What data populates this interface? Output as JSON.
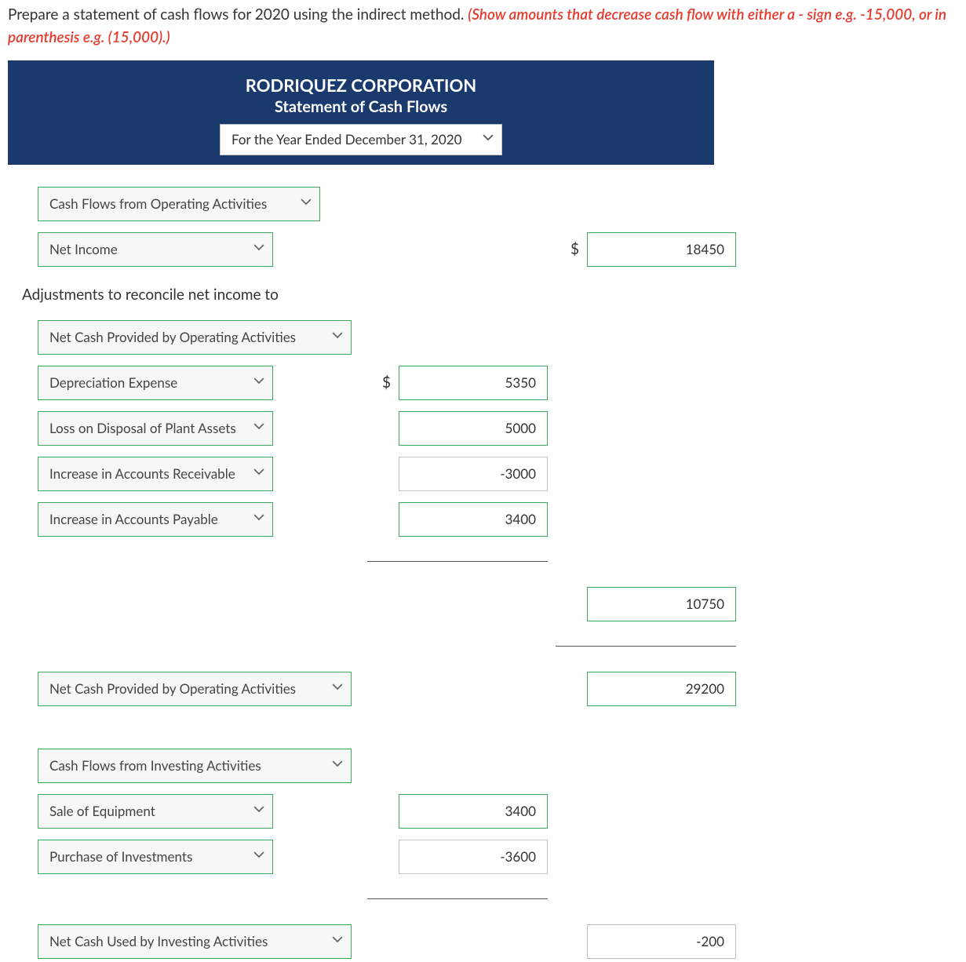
{
  "prompt": {
    "black": "Prepare a statement of cash flows for 2020 using the indirect method. ",
    "red": "(Show amounts that decrease cash flow with either a - sign e.g. -15,000, or in parenthesis e.g. (15,000).)"
  },
  "header": {
    "company": "RODRIQUEZ CORPORATION",
    "subtitle": "Statement of Cash Flows",
    "period": "For the Year Ended December 31, 2020"
  },
  "labels": {
    "cfo_header": "Cash Flows from Operating Activities",
    "net_income": "Net Income",
    "adjust_text": "Adjustments to reconcile net income to",
    "ncp_by_oa": "Net Cash Provided by Operating Activities",
    "depreciation": "Depreciation Expense",
    "loss_disposal": "Loss on Disposal of Plant Assets",
    "inc_ar": "Increase in Accounts Receivable",
    "inc_ap": "Increase in Accounts Payable",
    "ncp_by_oa2": "Net Cash Provided by Operating Activities",
    "cfi_header": "Cash Flows from Investing Activities",
    "sale_equip": "Sale of Equipment",
    "purch_inv": "Purchase of Investments",
    "nc_used_inv": "Net Cash Used by Investing Activities"
  },
  "values": {
    "net_income": "18450",
    "depreciation": "5350",
    "loss_disposal": "5000",
    "inc_ar": "-3000",
    "inc_ap": "3400",
    "adj_total": "10750",
    "oa_total": "29200",
    "sale_equip": "3400",
    "purch_inv": "-3600",
    "inv_total": "-200"
  },
  "sym": {
    "dollar": "$"
  }
}
